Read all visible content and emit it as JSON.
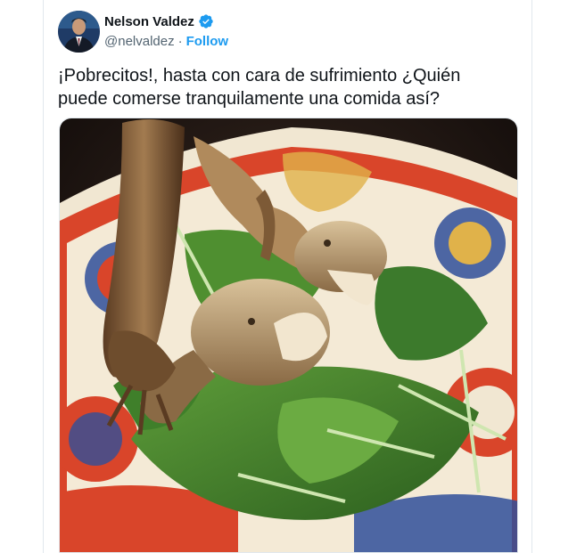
{
  "author": {
    "display_name": "Nelson Valdez",
    "handle": "@nelvaldez",
    "separator": "·",
    "follow_label": "Follow",
    "verified": true,
    "avatar_icon": "profile-photo"
  },
  "tweet": {
    "text": "¡Pobrecitos!, hasta con cara de sufrimiento ¿Quién puede comerse tranquilamente una comida así?"
  },
  "media": {
    "icon": "food-photo",
    "colors": {
      "plate_orange": "#d9452a",
      "plate_blue": "#2f4f9a",
      "greens": "#3c7a2c",
      "cream": "#f1e7d2"
    }
  },
  "colors": {
    "accent": "#1d9bf0",
    "text": "#0f1419",
    "muted": "#536471"
  }
}
